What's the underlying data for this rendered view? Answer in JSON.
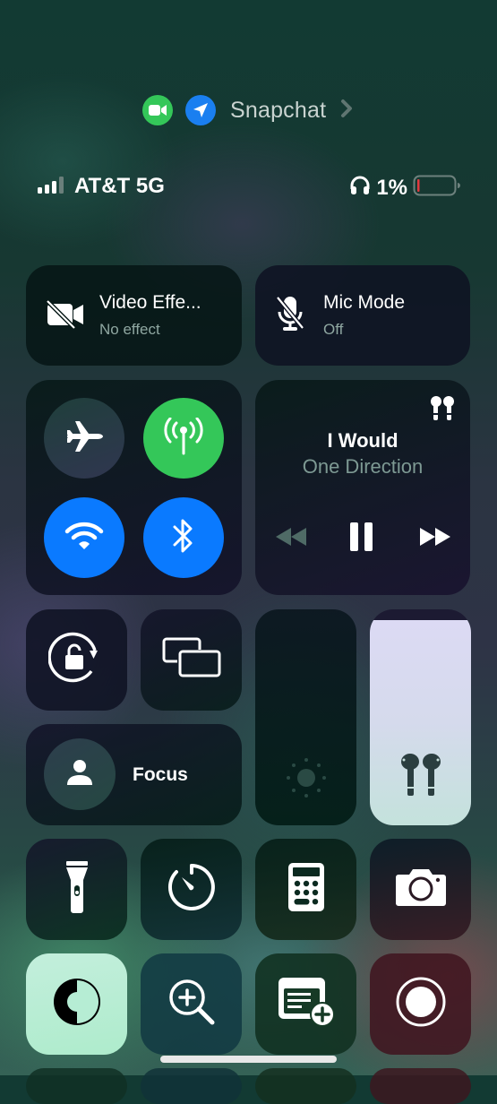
{
  "privacy_indicator": {
    "app_name": "Snapchat",
    "indicators": [
      {
        "icon": "video-camera-icon",
        "color": "#34c759"
      },
      {
        "icon": "location-arrow-icon",
        "color": "#1a7ff0"
      }
    ]
  },
  "status_bar": {
    "carrier": "AT&T 5G",
    "signal_bars_active": 3,
    "signal_bars_total": 4,
    "battery_percent": "1%",
    "battery_level": 0.01,
    "battery_color": "#e0383e",
    "headphones_icon": "headphones-icon"
  },
  "tiles": {
    "video_effects": {
      "title": "Video Effe...",
      "subtitle": "No effect"
    },
    "mic_mode": {
      "title": "Mic Mode",
      "subtitle": "Off"
    },
    "connectivity": {
      "airplane": {
        "label": "Airplane Mode",
        "on": false
      },
      "cellular": {
        "label": "Cellular Data",
        "on": true,
        "color": "#34c759"
      },
      "wifi": {
        "label": "Wi-Fi",
        "on": true,
        "color": "#0a7aff"
      },
      "bluetooth": {
        "label": "Bluetooth",
        "on": true,
        "color": "#0a7aff"
      }
    },
    "now_playing": {
      "title": "I Would",
      "artist": "One Direction",
      "output_device_icon": "airpods-icon",
      "state": "playing"
    },
    "focus": {
      "label": "Focus"
    },
    "brightness": {
      "level": 0.0
    },
    "volume": {
      "level": 0.95,
      "icon": "airpods-icon"
    },
    "controls_row1": [
      "Flashlight",
      "Timer",
      "Calculator",
      "Camera"
    ],
    "controls_row2": [
      "Dark Mode",
      "Magnifier",
      "Quick Note",
      "Screen Recording"
    ],
    "dark_mode_tile_color": "#b8ecd6"
  }
}
